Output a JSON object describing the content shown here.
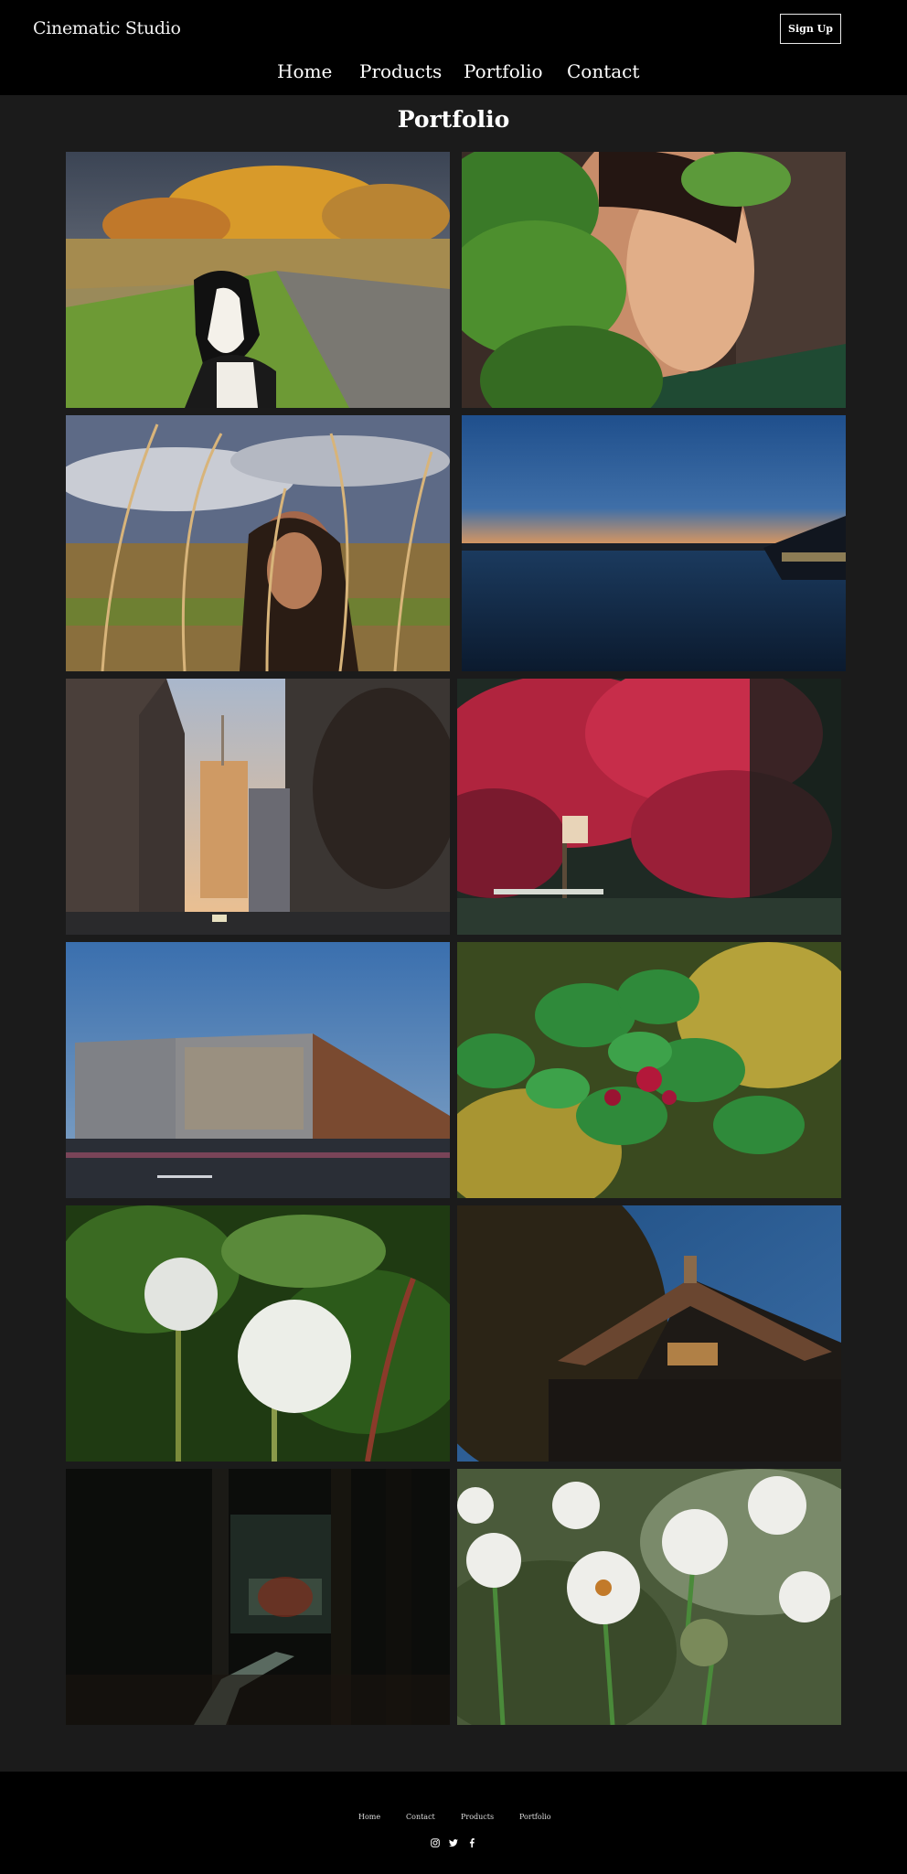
{
  "header": {
    "brand": "Cinematic Studio",
    "signup_label": "Sign Up",
    "nav": [
      "Home",
      "Products",
      "Portfolio",
      "Contact"
    ]
  },
  "main": {
    "title": "Portfolio",
    "gallery": [
      {
        "subject": "dog on autumn path"
      },
      {
        "subject": "portrait behind leaves"
      },
      {
        "subject": "woman in tall grass"
      },
      {
        "subject": "harbor at sunset"
      },
      {
        "subject": "city street towers"
      },
      {
        "subject": "red maple tree"
      },
      {
        "subject": "modern building at dusk"
      },
      {
        "subject": "berries among leaves"
      },
      {
        "subject": "dandelion seed heads"
      },
      {
        "subject": "temple roof"
      },
      {
        "subject": "dark forest path"
      },
      {
        "subject": "white wildflowers"
      }
    ]
  },
  "footer": {
    "links": [
      "Home",
      "Contact",
      "Products",
      "Portfolio"
    ],
    "social": [
      "instagram-icon",
      "twitter-icon",
      "facebook-icon"
    ]
  },
  "colors": {
    "header_bg": "#000000",
    "page_bg": "#1b1b1b",
    "text": "#ffffff"
  }
}
